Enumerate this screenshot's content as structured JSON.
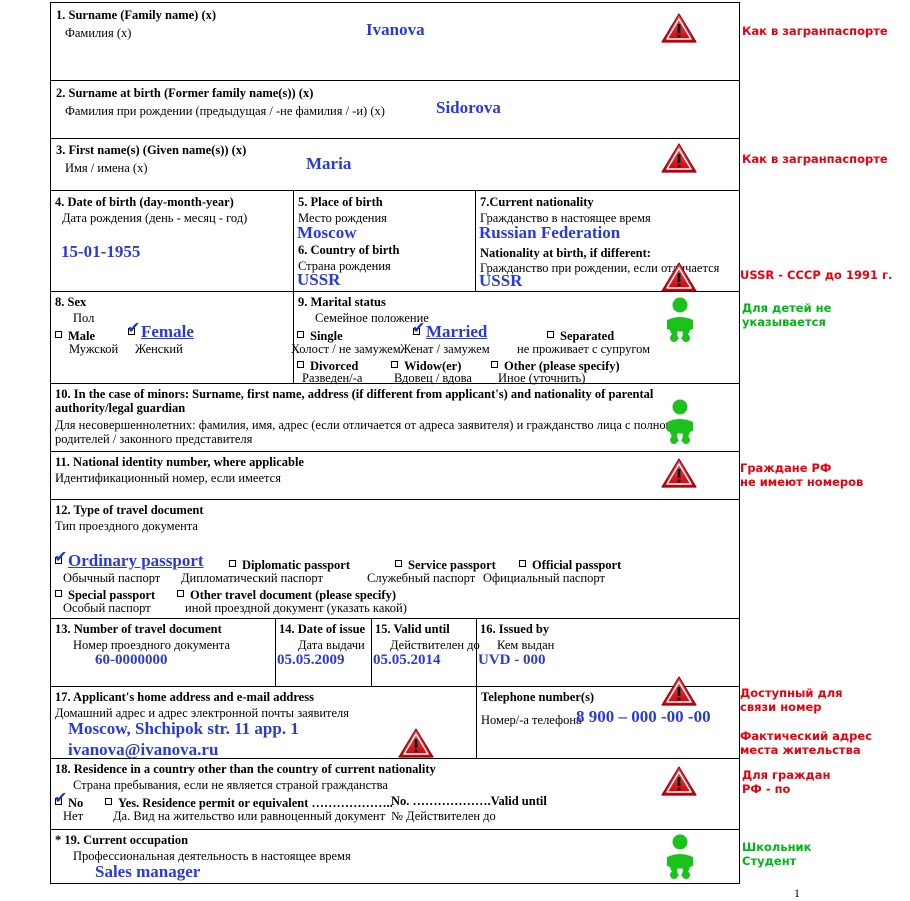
{
  "document": {
    "type": "schengen-visa-application-form",
    "page_number": "1"
  },
  "fields": [
    {
      "num": "1",
      "en": "1. Surname (Family name) (x)",
      "ru": "Фамилия (x)",
      "value": "Ivanova"
    },
    {
      "num": "2",
      "en": "2. Surname at birth (Former family name(s)) (x)",
      "ru": "Фамилия при рождении (предыдущая / -не фамилия / -и) (x)",
      "value": "Sidorova"
    },
    {
      "num": "3",
      "en": "3. First name(s) (Given name(s)) (x)",
      "ru": "Имя / имена (x)",
      "value": "Maria"
    },
    {
      "num": "4",
      "en": "4. Date of birth (day-month-year)",
      "ru": "Дата рождения (день - месяц - год)",
      "value": "15-01-1955"
    },
    {
      "num": "5",
      "en": "5. Place of birth",
      "ru": "Место рождения",
      "value": "Moscow"
    },
    {
      "num": "6",
      "en": "6. Country of birth",
      "ru": "Страна рождения",
      "value": "USSR"
    },
    {
      "num": "7",
      "en": "7.Current nationality",
      "ru": "Гражданство в настоящее время",
      "value": "Russian Federation",
      "en2": "Nationality at birth, if different:",
      "ru2": "Гражданство при рождении, если отличается",
      "value2": "USSR"
    },
    {
      "num": "8",
      "en": "8. Sex",
      "ru": "Пол",
      "options": [
        {
          "en": "Male",
          "ru": "Мужской",
          "checked": false
        },
        {
          "en": "Female",
          "ru": "Женский",
          "checked": true
        }
      ]
    },
    {
      "num": "9",
      "en": "9. Marital status",
      "ru": "Семейное положение",
      "options": [
        {
          "en": "Single",
          "ru": "Холост / не замужем",
          "checked": false
        },
        {
          "en": "Married",
          "ru": "Женат / замужем",
          "checked": true
        },
        {
          "en": "Separated",
          "ru": "не проживает с супругом",
          "checked": false
        },
        {
          "en": "Divorced",
          "ru": "Разведен/-а",
          "checked": false
        },
        {
          "en": "Widow(er)",
          "ru": "Вдовец / вдова",
          "checked": false
        },
        {
          "en": "Other (please specify)",
          "ru": "Иное (уточнить)",
          "checked": false
        }
      ]
    },
    {
      "num": "10",
      "en": "10. In the case of minors: Surname, first name, address (if different from applicant's) and nationality of parental authority/legal guardian",
      "ru": "Для несовершеннолетних: фамилия, имя, адрес (если отличается от адреса заявителя) и гражданство лица с полном родителей / законного представителя",
      "value": ""
    },
    {
      "num": "11",
      "en": "11. National identity number, where applicable",
      "ru": "Идентификационный номер, если имеется",
      "value": ""
    },
    {
      "num": "12",
      "en": "12. Type of travel document",
      "ru": "Тип проездного документа",
      "options": [
        {
          "en": "Ordinary passport",
          "ru": "Обычный паспорт",
          "checked": true
        },
        {
          "en": "Diplomatic passport",
          "ru": "Дипломатический паспорт",
          "checked": false
        },
        {
          "en": "Service passport",
          "ru": "Служебный паспорт",
          "checked": false
        },
        {
          "en": "Official passport",
          "ru": "Официальный паспорт",
          "checked": false
        },
        {
          "en": "Special passport",
          "ru": "Особый паспорт",
          "checked": false
        },
        {
          "en": "Other travel document (please specify)",
          "ru": "иной проездной документ (указать какой)",
          "checked": false
        }
      ]
    },
    {
      "num": "13",
      "en": "13. Number of travel document",
      "ru": "Номер проездного документа",
      "value": "60-0000000"
    },
    {
      "num": "14",
      "en": "14. Date of issue",
      "ru": "Дата выдачи",
      "value": "05.05.2009"
    },
    {
      "num": "15",
      "en": "15. Valid until",
      "ru": "Действителен до",
      "value": "05.05.2014"
    },
    {
      "num": "16",
      "en": "16. Issued by",
      "ru": "Кем выдан",
      "value": "UVD - 000"
    },
    {
      "num": "17",
      "en": "17. Applicant's home address and e-mail address",
      "ru": "Домашний адрес и адрес электронной почты заявителя",
      "value": "Moscow, Shchipok str. 11 app. 1",
      "value2": "ivanova@ivanova.ru"
    },
    {
      "num": "17b",
      "en": "Telephone number(s)",
      "ru": "Номер/-а телефона",
      "value": "8 900 – 000 -00 -00"
    },
    {
      "num": "18",
      "en": "18. Residence in a country other than the country of current nationality",
      "ru": "Страна пребывания, если не является страной гражданства",
      "options": [
        {
          "en": "No",
          "ru": "Нет",
          "checked": true
        },
        {
          "en": "Yes. Residence permit or equivalent ………………..",
          "ru": "Да. Вид на жительство или равноценный документ",
          "checked": false
        }
      ],
      "extra_en": "No. ……………….Valid until",
      "extra_ru": "№                      Действителен до"
    },
    {
      "num": "19",
      "en": "* 19. Current occupation",
      "ru": "Профессиональная деятельность в настоящее время",
      "value": "Sales manager"
    }
  ],
  "notes": [
    {
      "text": "Как в загранпаспорте",
      "color": "red"
    },
    {
      "text": "Как в загранпаспорте",
      "color": "red"
    },
    {
      "text": "USSR - СССР до 1991 г.",
      "color": "red"
    },
    {
      "text": "Для детей не\nуказывается",
      "color": "green"
    },
    {
      "text": "Граждане РФ\n не имеют номеров",
      "color": "red"
    },
    {
      "text": "Доступный для\nсвязи номер",
      "color": "red"
    },
    {
      "text": "Фактический адрес\nместа жительства",
      "color": "red"
    },
    {
      "text": "Для граждан\nРФ - по",
      "color": "red"
    },
    {
      "text": "Школьник\nСтудент",
      "color": "green"
    }
  ],
  "icons": {
    "warning": "warning-triangle-icon",
    "child": "child-icon"
  },
  "colors": {
    "value_blue": "#2a3ad6",
    "note_red": "#e8000d",
    "note_green": "#00b515",
    "warning_red": "#d81216",
    "border": "#000000"
  }
}
